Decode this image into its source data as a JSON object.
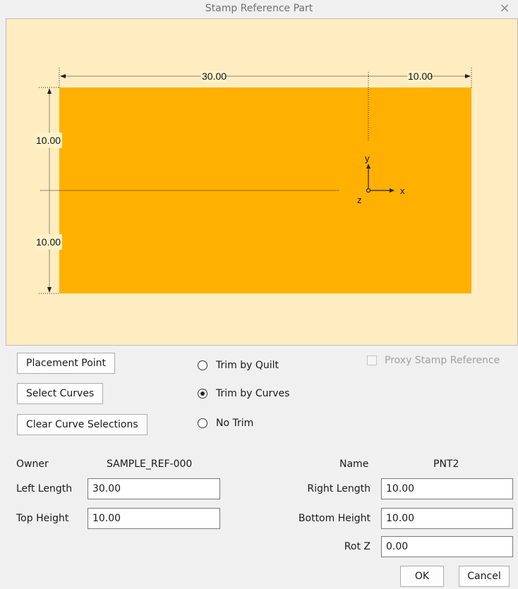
{
  "window": {
    "title": "Stamp Reference Part",
    "close_glyph": "×"
  },
  "preview": {
    "dimensions": {
      "left_length": "30.00",
      "right_length": "10.00",
      "top_height": "10.00",
      "bottom_height": "10.00"
    },
    "axis_labels": {
      "x": "x",
      "y": "y",
      "z": "z"
    },
    "colors": {
      "background": "#ffecc0",
      "part": "#ffb000"
    }
  },
  "buttons": {
    "placement_point": "Placement Point",
    "select_curves": "Select Curves",
    "clear_curve_selections": "Clear Curve Selections",
    "ok": "OK",
    "cancel": "Cancel"
  },
  "trim_options": [
    {
      "label": "Trim by Quilt",
      "selected": false
    },
    {
      "label": "Trim by Curves",
      "selected": true
    },
    {
      "label": "No Trim",
      "selected": false
    }
  ],
  "proxy_stamp_reference": {
    "label": "Proxy Stamp Reference",
    "checked": false,
    "enabled": false
  },
  "form": {
    "owner_label": "Owner",
    "owner_value": "SAMPLE_REF-000",
    "name_label": "Name",
    "name_value": "PNT2",
    "left_length_label": "Left Length",
    "left_length_value": "30.00",
    "right_length_label": "Right Length",
    "right_length_value": "10.00",
    "top_height_label": "Top Height",
    "top_height_value": "10.00",
    "bottom_height_label": "Bottom Height",
    "bottom_height_value": "10.00",
    "rot_z_label": "Rot Z",
    "rot_z_value": "0.00"
  }
}
